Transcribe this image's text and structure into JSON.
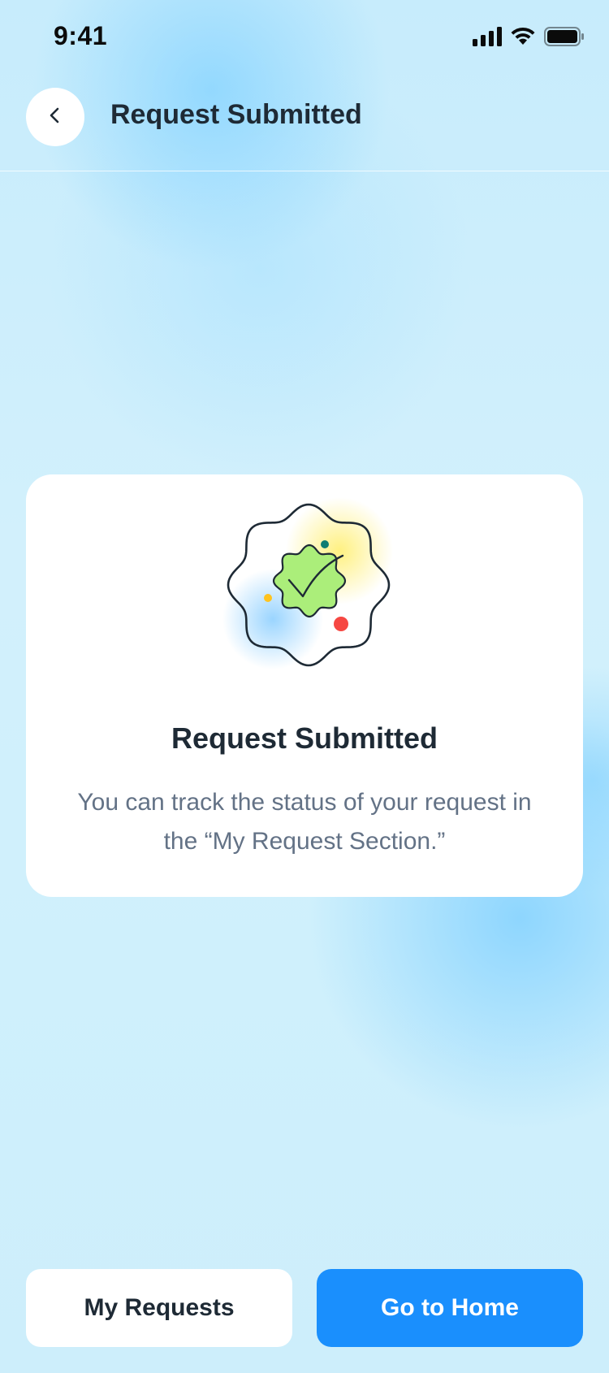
{
  "status_bar": {
    "time": "9:41",
    "icons": [
      "signal-icon",
      "wifi-icon",
      "battery-icon"
    ]
  },
  "header": {
    "back_icon": "chevron-left-icon",
    "title": "Request Submitted"
  },
  "card": {
    "illustration_icon": "success-badge-icon",
    "title": "Request Submitted",
    "message": "You can track the status of your request in the “My Request Section.”"
  },
  "actions": {
    "secondary_label": "My Requests",
    "primary_label": "Go to Home"
  },
  "colors": {
    "primary": "#1a8ffd",
    "badge_fill": "#abee7a",
    "text_dark": "#1e2a35",
    "text_muted": "#637286",
    "confetti_red": "#f64742",
    "confetti_yellow": "#ffc31f",
    "confetti_teal": "#0f7d72"
  }
}
